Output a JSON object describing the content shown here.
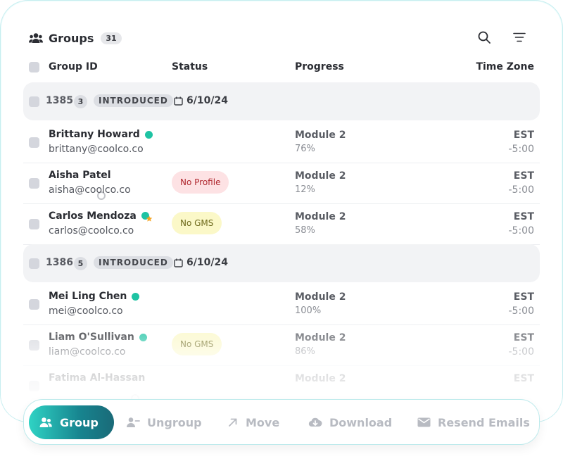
{
  "header": {
    "title": "Groups",
    "count": "31"
  },
  "columns": {
    "group_id": "Group ID",
    "status": "Status",
    "progress": "Progress",
    "time_zone": "Time Zone"
  },
  "groups": [
    {
      "id": "1385",
      "member_count": "3",
      "status": "INTRODUCED",
      "date": "6/10/24",
      "members": [
        {
          "name": "Brittany Howard",
          "email": "brittany@coolco.co",
          "online": "online",
          "status_pill": "",
          "module": "Module 2",
          "progress": "76%",
          "tz": "EST",
          "offset": "-5:00"
        },
        {
          "name": "Aisha Patel",
          "email": "aisha@coolco.co",
          "online": "offline",
          "status_pill": "No Profile",
          "module": "Module 2",
          "progress": "12%",
          "tz": "EST",
          "offset": "-5:00"
        },
        {
          "name": "Carlos Mendoza",
          "email": "carlos@coolco.co",
          "online": "online-star",
          "status_pill": "No GMS",
          "module": "Module 2",
          "progress": "58%",
          "tz": "EST",
          "offset": "-5:00"
        }
      ]
    },
    {
      "id": "1386",
      "member_count": "5",
      "status": "INTRODUCED",
      "date": "6/10/24",
      "members": [
        {
          "name": "Mei Ling Chen",
          "email": "mei@coolco.co",
          "online": "online",
          "status_pill": "",
          "module": "Module 2",
          "progress": "100%",
          "tz": "EST",
          "offset": "-5:00"
        },
        {
          "name": "Liam O'Sullivan",
          "email": "liam@coolco.co",
          "online": "online",
          "status_pill": "No GMS",
          "module": "Module 2",
          "progress": "86%",
          "tz": "EST",
          "offset": "-5:00"
        },
        {
          "name": "Fatima Al-Hassan",
          "email": "",
          "online": "offline",
          "status_pill": "",
          "module": "Module 2",
          "progress": "",
          "tz": "EST",
          "offset": ""
        }
      ]
    }
  ],
  "toolbar": {
    "group": "Group",
    "ungroup": "Ungroup",
    "move": "Move",
    "download": "Download",
    "resend": "Resend Emails"
  },
  "colors": {
    "accent_start": "#2fd3c4",
    "accent_end": "#1a6a78",
    "online": "#1ec3a3",
    "star": "#f5a524"
  }
}
